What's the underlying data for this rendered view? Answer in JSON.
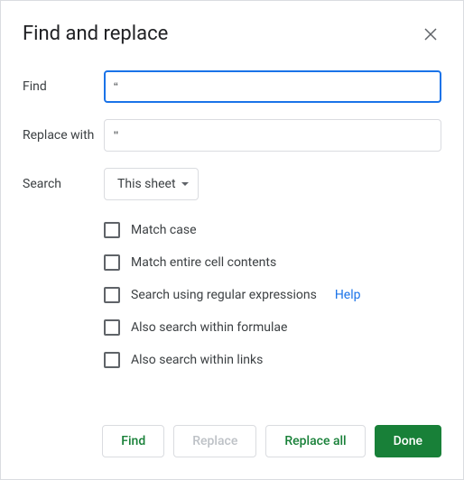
{
  "dialog": {
    "title": "Find and replace"
  },
  "fields": {
    "find_label": "Find",
    "find_value": "“",
    "replace_label": "Replace with",
    "replace_value": "\"",
    "search_label": "Search",
    "search_scope": "This sheet"
  },
  "options": {
    "match_case": "Match case",
    "match_entire": "Match entire cell contents",
    "regex": "Search using regular expressions",
    "regex_help": "Help",
    "formulae": "Also search within formulae",
    "links": "Also search within links"
  },
  "buttons": {
    "find": "Find",
    "replace": "Replace",
    "replace_all": "Replace all",
    "done": "Done"
  }
}
